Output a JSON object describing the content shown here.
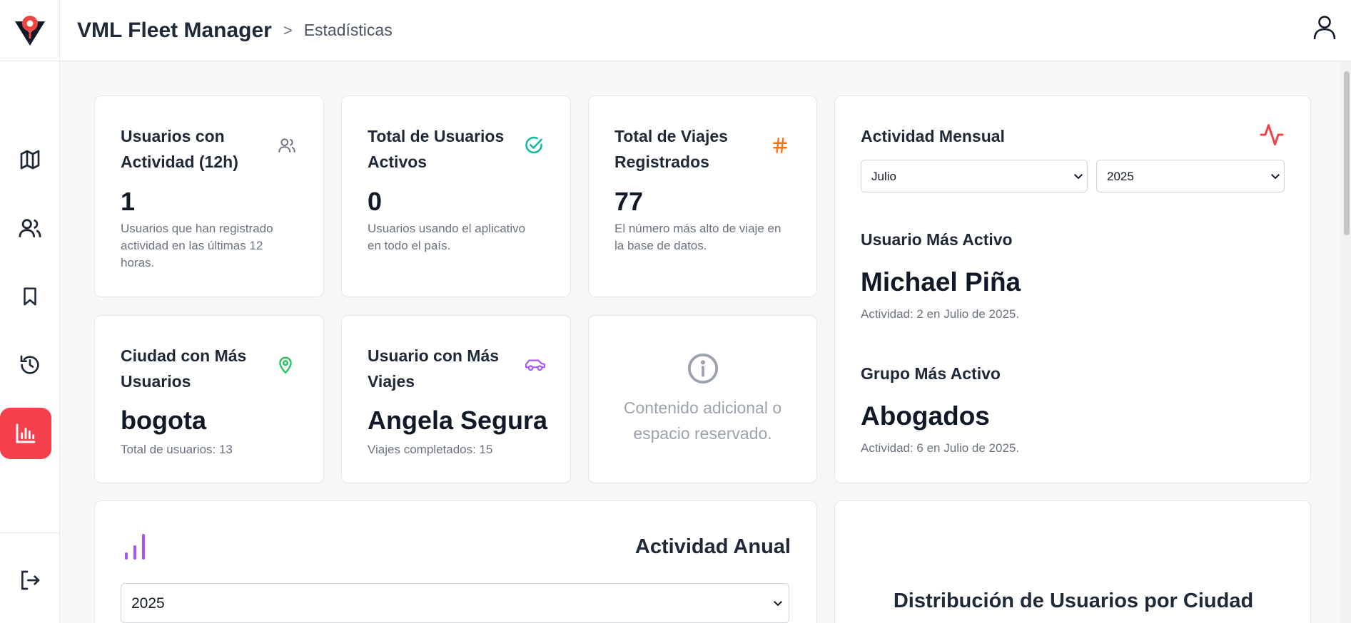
{
  "header": {
    "app_title": "VML Fleet Manager",
    "separator": ">",
    "breadcrumb": "Estadísticas"
  },
  "sidebar": {
    "items": [
      {
        "name": "map",
        "icon": "map-icon"
      },
      {
        "name": "users",
        "icon": "users-icon"
      },
      {
        "name": "bookmarks",
        "icon": "bookmark-icon"
      },
      {
        "name": "history",
        "icon": "history-icon"
      },
      {
        "name": "statistics",
        "icon": "bar-chart-icon",
        "active": true
      }
    ],
    "logout_icon": "logout-icon"
  },
  "stats": {
    "active_users_12h": {
      "title_line1": "Usuarios con",
      "title_line2": "Actividad (12h)",
      "value": "1",
      "desc_line1": "Usuarios que han registrado",
      "desc_line2": "actividad en las últimas 12",
      "desc_line3": "horas.",
      "icon": "users-icon"
    },
    "total_active_users": {
      "title_line1": "Total de Usuarios",
      "title_line2": "Activos",
      "value": "0",
      "desc_line1": "Usuarios usando el aplicativo",
      "desc_line2": "en todo el país.",
      "icon": "check-circle-icon"
    },
    "total_trips": {
      "title_line1": "Total de Viajes",
      "title_line2": "Registrados",
      "value": "77",
      "desc_line1": "El número más alto de viaje en",
      "desc_line2": "la base de datos.",
      "icon": "hash-icon"
    },
    "top_city": {
      "title_line1": "Ciudad con Más",
      "title_line2": "Usuarios",
      "value": "bogota",
      "desc": "Total de usuarios: 13",
      "icon": "map-pin-icon"
    },
    "top_user_trips": {
      "title_line1": "Usuario con Más",
      "title_line2": "Viajes",
      "value": "Angela Segura",
      "desc": "Viajes completados: 15",
      "icon": "car-icon"
    },
    "placeholder": {
      "line1": "Contenido adicional o",
      "line2": "espacio reservado.",
      "icon": "info-icon"
    }
  },
  "monthly": {
    "title": "Actividad Mensual",
    "month_selected": "Julio",
    "year_selected": "2025",
    "most_active_user_label": "Usuario Más Activo",
    "most_active_user": "Michael Piña",
    "most_active_user_note": "Actividad: 2 en Julio de 2025.",
    "most_active_group_label": "Grupo Más Activo",
    "most_active_group": "Abogados",
    "most_active_group_note": "Actividad: 6 en Julio de 2025.",
    "icon": "activity-icon"
  },
  "annual": {
    "title": "Actividad Anual",
    "year_selected": "2025",
    "icon": "bar-chart-icon"
  },
  "distribution": {
    "title": "Distribución de Usuarios por Ciudad"
  },
  "colors": {
    "accent": "#f43f4d",
    "teal": "#14b8a6",
    "orange": "#f97316",
    "green": "#22c55e",
    "purple": "#a855f7",
    "red": "#ef4444"
  }
}
